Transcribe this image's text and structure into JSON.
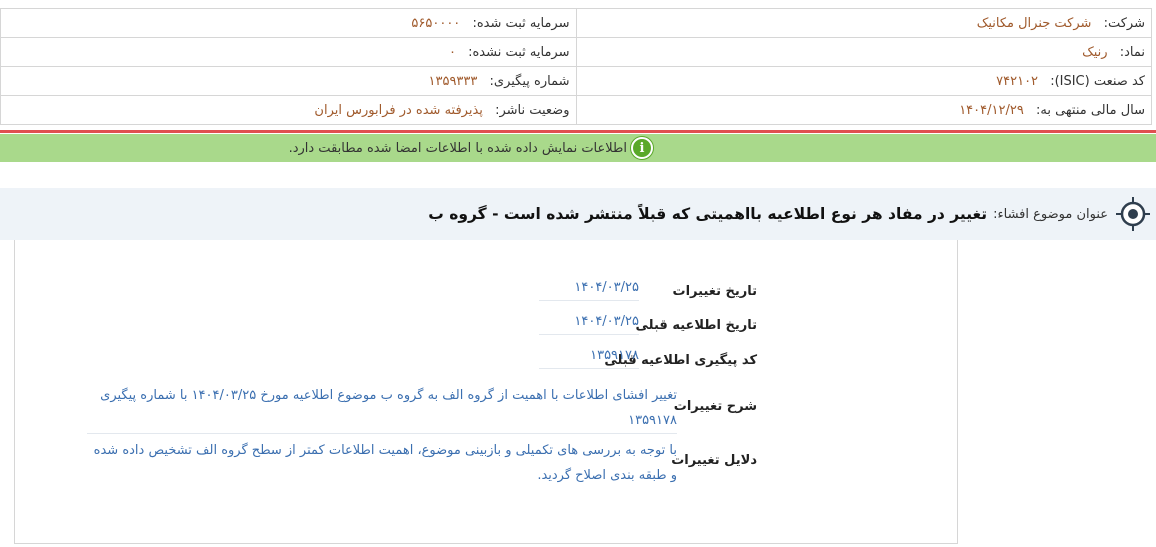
{
  "header": {
    "company_label": "شرکت:",
    "company_value": "شرکت جنرال مکانیک",
    "capital_label": "سرمایه ثبت شده:",
    "capital_value": "۵۶۵۰۰۰۰",
    "symbol_label": "نماد:",
    "symbol_value": "رنیک",
    "unregistered_capital_label": "سرمایه ثبت نشده:",
    "unregistered_capital_value": "۰",
    "isic_label": "کد صنعت (ISIC):",
    "isic_value": "۷۴۲۱۰۲",
    "tracking_label": "شماره پیگیری:",
    "tracking_value": "۱۳۵۹۳۳۳",
    "fiscal_label": "سال مالی منتهی به:",
    "fiscal_value": "۱۴۰۴/۱۲/۲۹",
    "publisher_status_label": "وضعیت ناشر:",
    "publisher_status_value": "پذیرفته شده در فرابورس ایران"
  },
  "notice": {
    "text": "اطلاعات نمایش داده شده با اطلاعات امضا شده مطابقت دارد."
  },
  "title": {
    "label": "عنوان موضوع افشاء:",
    "text": "تغییر در مفاد هر نوع اطلاعیه بااهمیتی که قبلاً منتشر شده است - گروه ب"
  },
  "details": [
    {
      "label": "تاریخ تغییرات",
      "value": "۱۴۰۴/۰۳/۲۵"
    },
    {
      "label": "تاریخ اطلاعیه قبلی",
      "value": "۱۴۰۴/۰۳/۲۵"
    },
    {
      "label": "کد پیگیری اطلاعیه قبلی",
      "value": "۱۳۵۹۱۷۸"
    },
    {
      "label": "شرح تغییرات",
      "value": "تغییر افشای اطلاعات با اهمیت از گروه الف به گروه ب موضوع اطلاعیه مورخ ۱۴۰۴/۰۳/۲۵ با شماره پیگیری ۱۳۵۹۱۷۸"
    },
    {
      "label": "دلایل تغییرات",
      "value": "با توجه به بررسی های تکمیلی و بازبینی موضوع، اهمیت اطلاعات کمتر از سطح گروه الف تشخیص داده شده و طبقه بندی اصلاح گردید."
    }
  ],
  "colors": {
    "value_brown": "#a05a2c",
    "value_blue": "#3b6fb0",
    "notice_bg": "#a9d98b",
    "divider_red": "#e05050"
  },
  "icons": {
    "notice": "info-icon",
    "title": "target-icon"
  }
}
